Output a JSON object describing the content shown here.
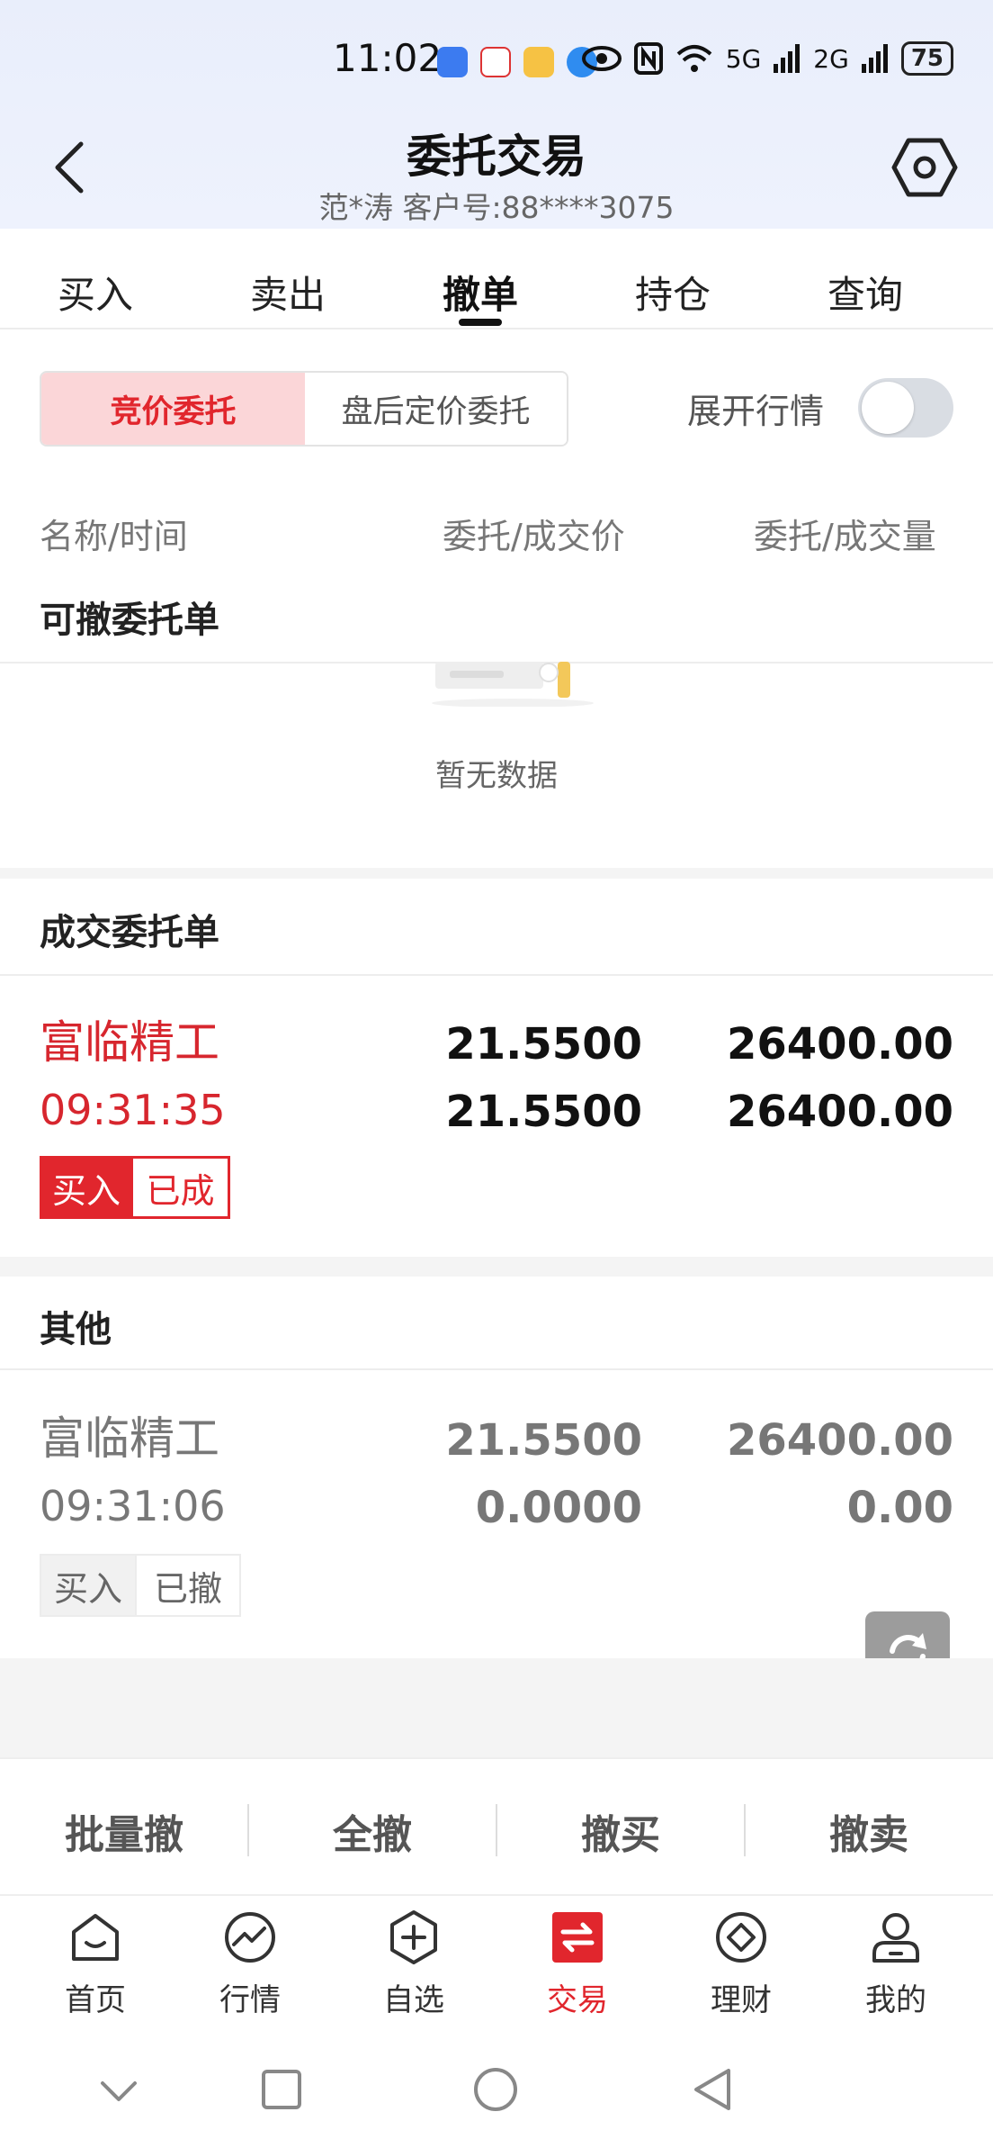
{
  "status_bar": {
    "time": "11:02",
    "battery": "75",
    "net1": "5G",
    "net2": "2G"
  },
  "header": {
    "title": "委托交易",
    "subtitle": "范*涛 客户号:88****3075"
  },
  "tabs": [
    {
      "label": "买入"
    },
    {
      "label": "卖出"
    },
    {
      "label": "撤单"
    },
    {
      "label": "持仓"
    },
    {
      "label": "查询"
    }
  ],
  "active_tab": "撤单",
  "segment": {
    "option1": "竞价委托",
    "option2": "盘后定价委托"
  },
  "expand_quotes": {
    "label": "展开行情",
    "on": false
  },
  "columns": {
    "col1": "名称/时间",
    "col2": "委托/成交价",
    "col3": "委托/成交量"
  },
  "sections": {
    "cancelable": {
      "title": "可撤委托单",
      "empty_text": "暂无数据"
    },
    "filled": {
      "title": "成交委托单",
      "order": {
        "name": "富临精工",
        "time": "09:31:35",
        "entrust_price": "21.5500",
        "deal_price": "21.5500",
        "entrust_qty": "26400.00",
        "deal_qty": "26400.00",
        "side": "买入",
        "status": "已成"
      }
    },
    "other": {
      "title": "其他",
      "order": {
        "name": "富临精工",
        "time": "09:31:06",
        "entrust_price": "21.5500",
        "deal_price": "0.0000",
        "entrust_qty": "26400.00",
        "deal_qty": "0.00",
        "side": "买入",
        "status": "已撤"
      }
    }
  },
  "actions": {
    "batch": "批量撤",
    "all": "全撤",
    "buy": "撤买",
    "sell": "撤卖"
  },
  "bottom_nav": [
    {
      "label": "首页",
      "icon": "home-icon"
    },
    {
      "label": "行情",
      "icon": "chart-icon"
    },
    {
      "label": "自选",
      "icon": "plus-hex-icon"
    },
    {
      "label": "交易",
      "icon": "trade-icon"
    },
    {
      "label": "理财",
      "icon": "wealth-icon"
    },
    {
      "label": "我的",
      "icon": "user-icon"
    }
  ],
  "colors": {
    "accent_red": "#e1262d",
    "segment_bg": "#fbd6d8"
  }
}
